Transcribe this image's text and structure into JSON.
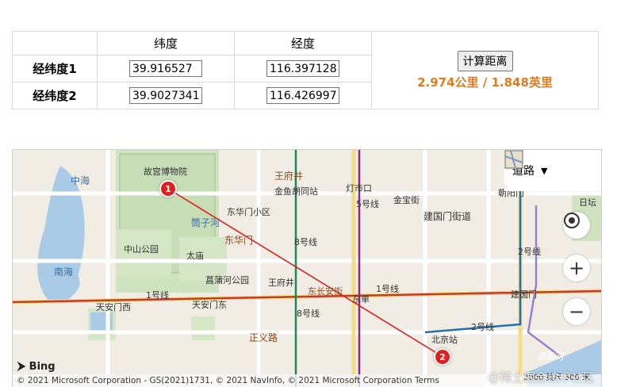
{
  "table": {
    "header_lat": "纬度",
    "header_lng": "经度",
    "rows": [
      {
        "label": "经纬度1",
        "lat": "39.916527",
        "lng": "116.397128"
      },
      {
        "label": "经纬度2",
        "lat": "39.9027341",
        "lng": "116.426997"
      }
    ],
    "button_label": "计算距离",
    "result": "2.974公里 / 1.848英里"
  },
  "map": {
    "style_label": "道路",
    "labels": {
      "zhonghai": "中海",
      "gugong": "故宫博物院",
      "nanhai": "南海",
      "zhongshan": "中山公园",
      "taimiao": "太庙",
      "tongzihe": "筒子河",
      "dhmxq": "东华门小区",
      "donghuamen": "东华门",
      "wangfujing": "王府井",
      "wfj_line": "王府井",
      "jinyu": "金鱼胡同站",
      "dengshikou": "灯市口",
      "jinbao": "金宝街",
      "jgmjd": "建国门街道",
      "chaoyangmen": "朝阳门",
      "tiananmen_w": "天安门西",
      "tiananmen_e": "天安门东",
      "line1": "1号线",
      "line1b": "1号线",
      "line2": "2号线",
      "line2b": "2号线",
      "line8": "8号线",
      "line8b": "8号线",
      "line5": "5号线",
      "dongdan": "东单",
      "dongchangan": "东长安街",
      "changpugong": "菖蒲河公园",
      "zhengyi": "正义路",
      "beijingzhan": "北京站",
      "jianguomen": "建国门",
      "ritan": "日坛",
      "tongji": "通惠河"
    },
    "markers": [
      "1",
      "2"
    ],
    "bing": "Bing",
    "attribution": "© 2021 Microsoft Corporation - GS(2021)1731, © 2021 NavInfo, © 2021 Microsoft Corporation  Terms",
    "scale": "2000 英尺   500 米",
    "watermark": "@稀土掘金技术社区"
  },
  "colors": {
    "accent": "#e07b1c",
    "marker": "#e0201e",
    "route": "#e0201e"
  }
}
